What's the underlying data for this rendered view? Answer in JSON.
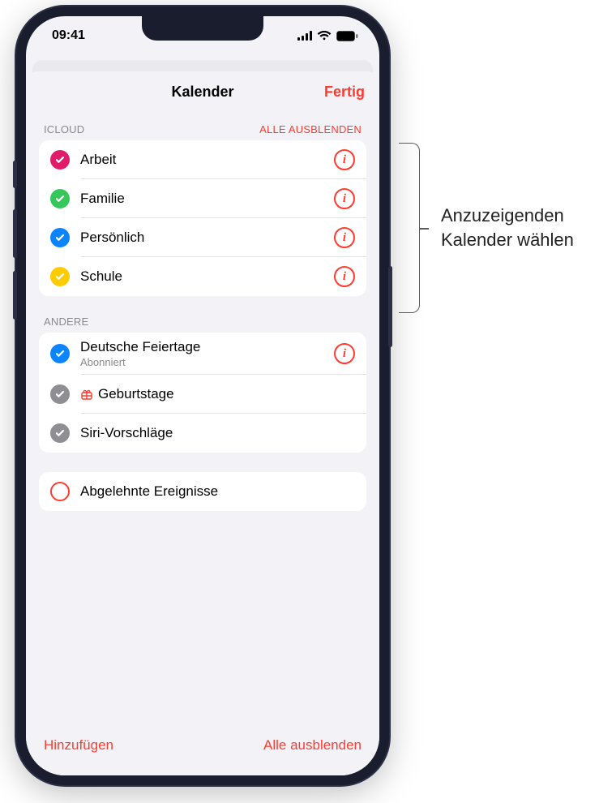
{
  "status": {
    "time": "09:41"
  },
  "nav": {
    "title": "Kalender",
    "done": "Fertig"
  },
  "sections": {
    "icloud": {
      "header": "ICLOUD",
      "action": "ALLE AUSBLENDEN",
      "items": [
        {
          "label": "Arbeit",
          "color": "#e11a6b",
          "checked": true,
          "info": true
        },
        {
          "label": "Familie",
          "color": "#34c759",
          "checked": true,
          "info": true
        },
        {
          "label": "Persönlich",
          "color": "#0a84ff",
          "checked": true,
          "info": true
        },
        {
          "label": "Schule",
          "color": "#ffcc00",
          "checked": true,
          "info": true
        }
      ]
    },
    "andere": {
      "header": "ANDERE",
      "items": [
        {
          "label": "Deutsche Feiertage",
          "sub": "Abonniert",
          "color": "#0a84ff",
          "checked": true,
          "info": true
        },
        {
          "label": "Geburtstage",
          "icon": "gift",
          "color": "#8e8e93",
          "checked": true,
          "info": false
        },
        {
          "label": "Siri-Vorschläge",
          "color": "#8e8e93",
          "checked": true,
          "info": false
        }
      ]
    },
    "declined": {
      "items": [
        {
          "label": "Abgelehnte Ereignisse",
          "checked": false
        }
      ]
    }
  },
  "toolbar": {
    "add": "Hinzufügen",
    "hideAll": "Alle ausblenden"
  },
  "callout": {
    "line1": "Anzuzeigenden",
    "line2": "Kalender wählen"
  }
}
